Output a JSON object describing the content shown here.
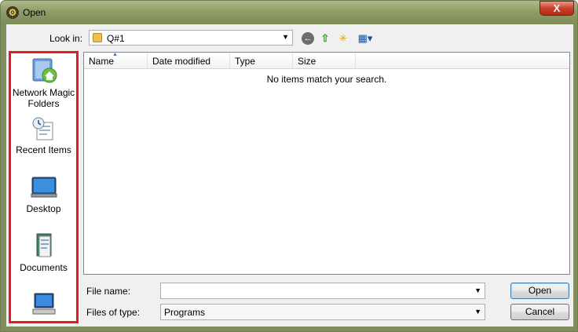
{
  "window": {
    "title": "Open",
    "close_glyph": "X"
  },
  "toolbar": {
    "lookin_label": "Look in:",
    "lookin_value": "Q#1",
    "icons": [
      "back-icon",
      "up-folder-icon",
      "new-folder-icon",
      "views-menu-icon"
    ]
  },
  "places": [
    {
      "label_line1": "Network Magic",
      "label_line2": "Folders",
      "icon": "network-magic-folders-icon"
    },
    {
      "label_line1": "Recent Items",
      "icon": "recent-items-icon"
    },
    {
      "label_line1": "Desktop",
      "icon": "desktop-icon"
    },
    {
      "label_line1": "Documents",
      "icon": "documents-icon"
    },
    {
      "label_line1": "",
      "icon": "computer-icon"
    }
  ],
  "filelist": {
    "columns": [
      "Name",
      "Date modified",
      "Type",
      "Size"
    ],
    "empty_message": "No items match your search."
  },
  "bottom": {
    "filename_label": "File name:",
    "filename_value": "",
    "filetype_label": "Files of type:",
    "filetype_value": "Programs",
    "open_label": "Open",
    "cancel_label": "Cancel"
  },
  "colors": {
    "highlight_border": "#e81c1c",
    "titlebar": "#8f9e67"
  }
}
